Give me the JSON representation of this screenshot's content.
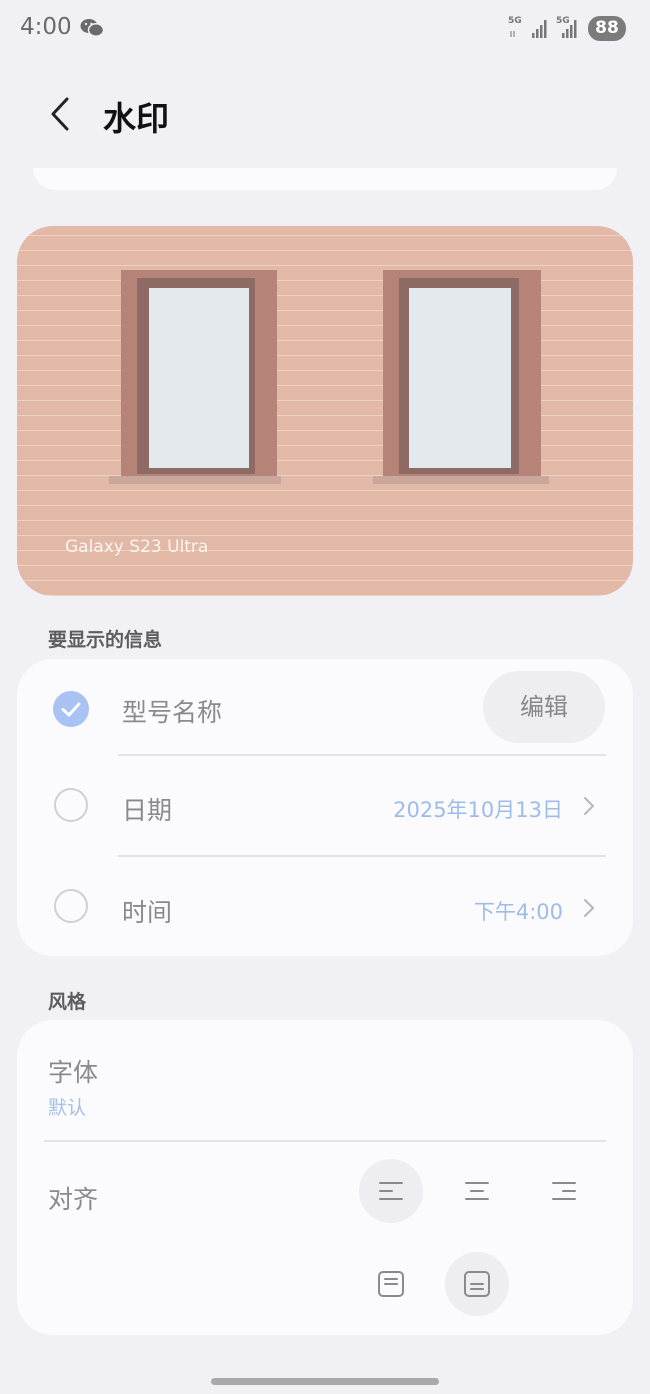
{
  "status_bar": {
    "time": "4:00",
    "network_1": "5G",
    "network_2": "5G",
    "battery": "88"
  },
  "header": {
    "title": "水印"
  },
  "preview": {
    "watermark_text": "Galaxy S23 Ultra"
  },
  "info_section": {
    "title": "要显示的信息",
    "items": [
      {
        "label": "型号名称",
        "checked": true,
        "action": "编辑"
      },
      {
        "label": "日期",
        "checked": false,
        "value": "2025年10月13日"
      },
      {
        "label": "时间",
        "checked": false,
        "value": "下午4:00"
      }
    ]
  },
  "style_section": {
    "title": "风格",
    "font_label": "字体",
    "font_value": "默认",
    "align_label": "对齐",
    "align_options": [
      "align-left",
      "align-center",
      "align-right",
      "position-top",
      "position-bottom"
    ],
    "selected_align": "align-left",
    "selected_position": "position-bottom"
  },
  "colors": {
    "accent": "#a8c2f3",
    "value_text": "#9fbbe8",
    "card_bg": "#fbfbfe",
    "page_bg": "#f1f0f5"
  }
}
